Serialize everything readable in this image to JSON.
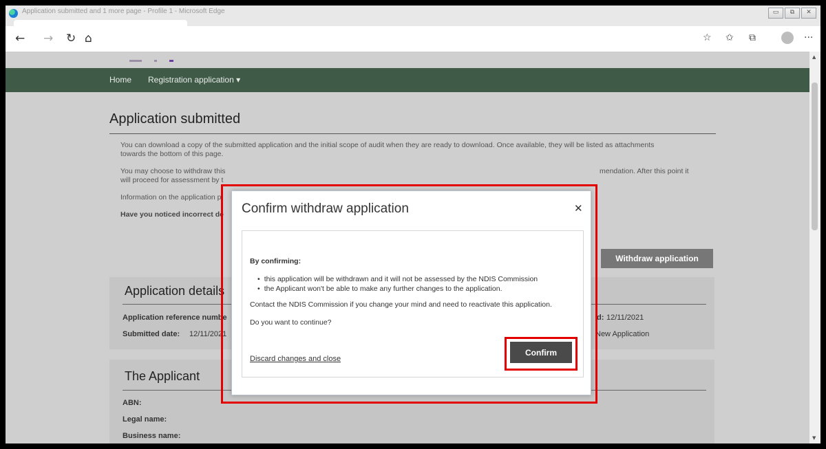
{
  "window": {
    "title": "Application submitted and 1 more page - Profile 1 - Microsoft Edge"
  },
  "browser": {
    "back": "←",
    "forward": "→",
    "refresh": "↻",
    "home": "⌂",
    "favorites_add": "☆",
    "favorites": "✩",
    "collections": "⧉",
    "more": "···"
  },
  "nav": {
    "home": "Home",
    "registration": "Registration application ▾"
  },
  "page": {
    "heading": "Application submitted",
    "p1a": "You can download a copy of the submitted application and the initial scope of audit when they are ready to download. Once available, they will be listed as attachments",
    "p1b": "towards the bottom of this page.",
    "p2a": "You may choose to withdraw this",
    "p2b": "mendation. After this point it",
    "p2c": "will proceed for assessment by t",
    "p3": "Information on the application p",
    "p4": "Have you noticed incorrect de",
    "withdraw_button": "Withdraw application"
  },
  "details": {
    "heading": "Application details",
    "ref_label": "Application reference numbe",
    "submitted_label": "Submitted date:",
    "submitted_value": "12/11/2021",
    "right_label": "d:",
    "right_value": "12/11/2021",
    "type_value": "New Application"
  },
  "applicant": {
    "heading": "The Applicant",
    "abn": "ABN:",
    "legal": "Legal name:",
    "business": "Business name:"
  },
  "modal": {
    "title": "Confirm withdraw application",
    "close": "✕",
    "by_confirming": "By confirming:",
    "bullet1": "this application will be withdrawn and it will not be assessed by the NDIS Commission",
    "bullet2": "the Applicant won't be able to make any further changes to the application.",
    "contact": "Contact the NDIS Commission if you change your mind and need to reactivate this application.",
    "question": "Do you want to continue?",
    "discard": "Discard changes and close",
    "confirm": "Confirm"
  },
  "colors": {
    "nav": "#405a48",
    "highlight": "#e20000",
    "confirm": "#4a4a4a"
  }
}
